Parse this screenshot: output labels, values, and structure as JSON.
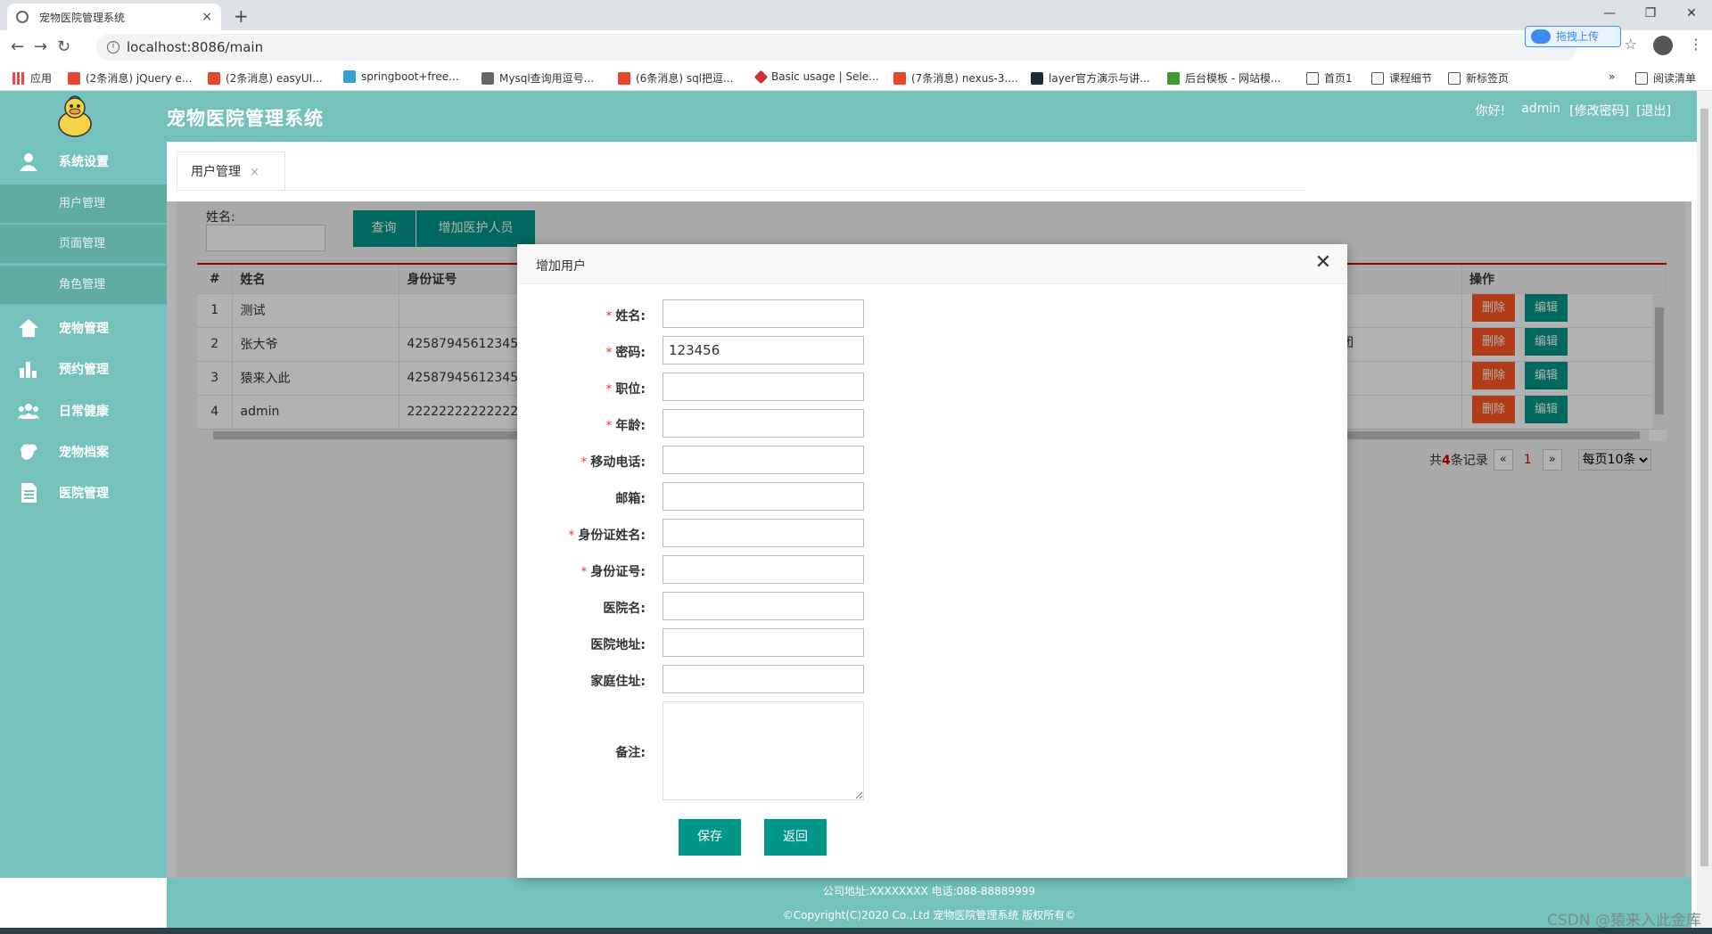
{
  "browser": {
    "tab_title": "宠物医院管理系统",
    "tab_close": "×",
    "new_tab": "+",
    "url": "localhost:8086/main",
    "upload_label": "拖拽上传",
    "bookmarks": [
      {
        "label": "应用",
        "icon": "apps-icon"
      },
      {
        "label": "(2条消息) jQuery e...",
        "icon": "csdn-icon"
      },
      {
        "label": "(2条消息) easyUI...",
        "icon": "csdn-icon"
      },
      {
        "label": "springboot+free...",
        "icon": "bilibili-icon"
      },
      {
        "label": "Mysql查询用逗号...",
        "icon": "mysql-icon"
      },
      {
        "label": "(6条消息) sql把逗...",
        "icon": "csdn-icon"
      },
      {
        "label": "Basic usage | Sele...",
        "icon": "selenium-icon"
      },
      {
        "label": "(7条消息) nexus-3....",
        "icon": "csdn-icon"
      },
      {
        "label": "layer官方演示与讲...",
        "icon": "layer-icon"
      },
      {
        "label": "后台模板 - 网站模...",
        "icon": "m-icon"
      },
      {
        "label": "首页1",
        "icon": "globe-icon"
      },
      {
        "label": "课程细节",
        "icon": "globe-icon"
      },
      {
        "label": "新标签页",
        "icon": "globe-icon"
      }
    ],
    "more": "»",
    "reading_list": "阅读清单"
  },
  "app": {
    "title": "宠物医院管理系统",
    "greeting": "你好!",
    "username": "admin",
    "change_password": "[修改密码]",
    "logout": "[退出]"
  },
  "sidebar": {
    "items": [
      {
        "label": "系统设置",
        "icon": "user-icon"
      },
      {
        "label": "宠物管理",
        "icon": "home-icon"
      },
      {
        "label": "预约管理",
        "icon": "bar-chart-icon"
      },
      {
        "label": "日常健康",
        "icon": "group-icon"
      },
      {
        "label": "宠物档案",
        "icon": "pet-icon"
      },
      {
        "label": "医院管理",
        "icon": "document-icon"
      }
    ],
    "subitems": [
      "用户管理",
      "页面管理",
      "角色管理"
    ]
  },
  "page_tab": {
    "label": "用户管理",
    "close": "×"
  },
  "search": {
    "label": "姓名:",
    "query_button": "查询",
    "add_button": "增加医护人员"
  },
  "table": {
    "headers": [
      "#",
      "姓名",
      "身份证号",
      "操作"
    ],
    "rows": [
      {
        "idx": "1",
        "name": "测试",
        "idcard": ""
      },
      {
        "idx": "2",
        "name": "张大爷",
        "idcard": "42587945612345"
      },
      {
        "idx": "3",
        "name": "猿来入此",
        "idcard": "42587945612345"
      },
      {
        "idx": "4",
        "name": "admin",
        "idcard": "22222222222222"
      }
    ],
    "row2_extra": "集团",
    "delete_label": "删除",
    "edit_label": "编辑"
  },
  "pager": {
    "prefix": "共",
    "total": "4",
    "suffix": "条记录",
    "prev": "«",
    "current": "1",
    "next": "»",
    "page_size": "每页10条"
  },
  "modal": {
    "title": "增加用户",
    "close": "✕",
    "fields": [
      {
        "label": "姓名:",
        "required": true,
        "value": ""
      },
      {
        "label": "密码:",
        "required": true,
        "value": "123456"
      },
      {
        "label": "职位:",
        "required": true,
        "value": ""
      },
      {
        "label": "年龄:",
        "required": true,
        "value": ""
      },
      {
        "label": "移动电话:",
        "required": true,
        "value": ""
      },
      {
        "label": "邮箱:",
        "required": false,
        "value": ""
      },
      {
        "label": "身份证姓名:",
        "required": true,
        "value": ""
      },
      {
        "label": "身份证号:",
        "required": true,
        "value": ""
      },
      {
        "label": "医院名:",
        "required": false,
        "value": ""
      },
      {
        "label": "医院地址:",
        "required": false,
        "value": ""
      },
      {
        "label": "家庭住址:",
        "required": false,
        "value": ""
      }
    ],
    "required_mark": "*",
    "remark_label": "备注:",
    "save": "保存",
    "back": "返回"
  },
  "footer": {
    "line1": "公司地址:XXXXXXXX 电话:088-88889999",
    "line2": "©Copyright(C)2020 Co.,Ltd 宠物医院管理系统 版权所有©"
  },
  "watermark": "CSDN @猿来入此金库",
  "colors": {
    "header": "#75c2bd",
    "teal_button": "#009688",
    "delete_button": "#ff5722"
  }
}
